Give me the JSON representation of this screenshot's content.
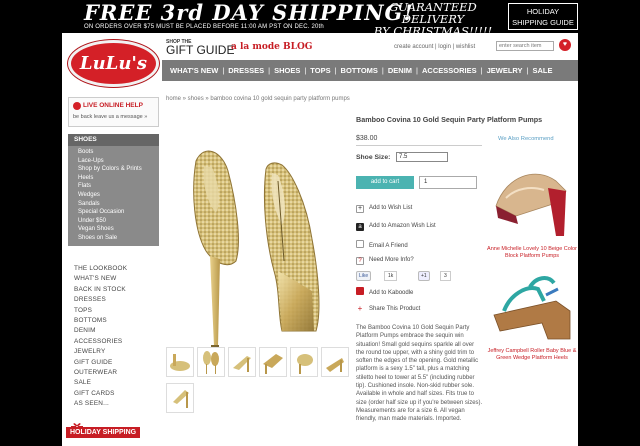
{
  "promo": {
    "headline": "FREE 3rd DAY SHIPPING!",
    "subline": "ON ORDERS OVER $75   MUST BE PLACED BEFORE 11:00 AM PST ON DEC. 20th",
    "guarantee_line1": "GUARANTEED DELIVERY",
    "guarantee_line2": "BY CHRISTMAS!!!!!",
    "holiday_btn_line1": "HOLIDAY",
    "holiday_btn_line2": "SHIPPING GUIDE"
  },
  "header": {
    "logo": "LuLu's",
    "shop_the": "SHOP THE",
    "gift_guide": "GIFT GUIDE",
    "blog": "a la mode BLOG",
    "links": "create account | login | wishlist",
    "search_placeholder": "enter search item"
  },
  "nav": [
    "WHAT'S NEW",
    "DRESSES",
    "SHOES",
    "TOPS",
    "BOTTOMS",
    "DENIM",
    "ACCESSORIES",
    "JEWELRY",
    "SALE"
  ],
  "live_help": {
    "title": "LIVE ONLINE HELP",
    "sub": "be back leave us a message »"
  },
  "sidebar": {
    "heading": "SHOES",
    "sub_items": [
      "Boots",
      "Lace-Ups",
      "Shop by Colors & Prints",
      "Heels",
      "Flats",
      "Wedges",
      "Sandals",
      "Special Occasion",
      "Under $50",
      "Vegan Shoes",
      "Shoes on Sale"
    ],
    "main_items": [
      "THE LOOKBOOK",
      "WHAT'S NEW",
      "BACK IN STOCK",
      "DRESSES",
      "TOPS",
      "BOTTOMS",
      "DENIM",
      "ACCESSORIES",
      "JEWELRY",
      "GIFT GUIDE",
      "OUTERWEAR",
      "SALE",
      "GIFT CARDS",
      "AS SEEN..."
    ],
    "holiday": "HOLIDAY SHIPPING"
  },
  "breadcrumb": "home » shoes » bamboo covina 10 gold sequin party platform pumps",
  "product": {
    "title": "Bamboo Covina 10 Gold Sequin Party Platform Pumps",
    "price": "$38.00",
    "recommend": "We Also Recommend",
    "size_label": "Shoe Size:",
    "size_value": "7.5",
    "add_to_cart": "add to cart",
    "qty": "1",
    "actions": [
      {
        "label": "Add to Wish List",
        "icon": "plus-icon"
      },
      {
        "label": "Add to Amazon Wish List",
        "icon": "amazon-icon"
      },
      {
        "label": "Email A Friend",
        "icon": "email-icon"
      },
      {
        "label": "Need More Info?",
        "icon": "question-icon"
      },
      {
        "label": "Add to Kaboodle",
        "icon": "kaboodle-icon"
      },
      {
        "label": "Share This Product",
        "icon": "share-icon"
      }
    ],
    "share": {
      "like": "Like",
      "like_count": "1k",
      "plus": "+1",
      "plus_count": "3"
    },
    "description": "The Bamboo Covina 10 Gold Sequin Party Platform Pumps embrace the sequin win situation! Small gold sequins sparkle all over the round toe upper, with a shiny gold trim to soften the edges of the opening. Gold metallic platform is a sexy 1.5\" tall, plus a matching stiletto heel to tower at 5.5\" (including rubber tip). Cushioned insole. Non-skid rubber sole. Available in whole and half sizes. Fits true to size (order half size up if you're between sizes). Measurements are for a size 6. All vegan friendly, man made materials. Imported."
  },
  "recommendations": [
    {
      "caption": "Anne Michelle Lovely 10 Beige Color Block Platform Pumps"
    },
    {
      "caption": "Jeffrey Campbell Roller Baby Blue & Green Wedge Platform Heels"
    }
  ]
}
